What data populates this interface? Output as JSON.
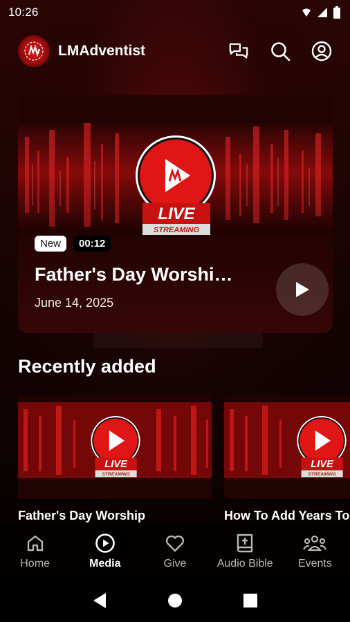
{
  "status_bar": {
    "time": "10:26"
  },
  "app": {
    "title": "LMAdventist"
  },
  "hero": {
    "badge": "New",
    "duration": "00:12",
    "title": "Father's Day Worshi…",
    "date": "June 14, 2025",
    "live_text": "LIVE",
    "streaming_text": "STREAMING"
  },
  "recent": {
    "heading": "Recently added",
    "items": [
      {
        "title": "Father's Day Worship"
      },
      {
        "title": "How To Add Years To"
      }
    ]
  },
  "nav": {
    "items": [
      {
        "label": "Home",
        "icon": "home-icon"
      },
      {
        "label": "Media",
        "icon": "play-circle-icon"
      },
      {
        "label": "Give",
        "icon": "heart-icon"
      },
      {
        "label": "Audio Bible",
        "icon": "bible-icon"
      },
      {
        "label": "Events",
        "icon": "people-icon"
      }
    ],
    "active_index": 1
  },
  "colors": {
    "accent": "#e01515",
    "background": "#0d0202",
    "nav_inactive": "#bdb6b6"
  }
}
